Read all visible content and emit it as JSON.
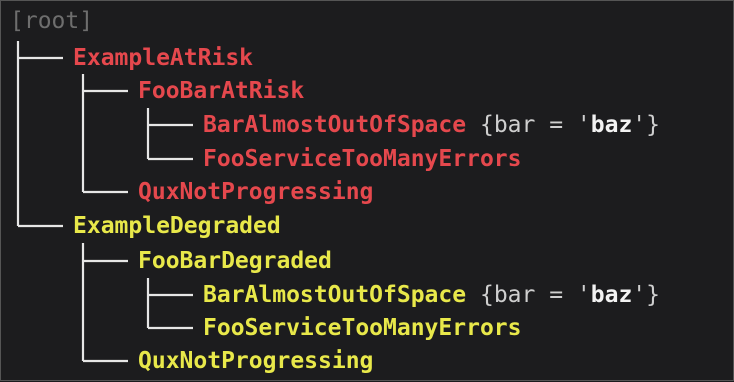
{
  "root": "[root]",
  "colors": {
    "at_risk": "#e5484d",
    "degraded": "#e8e84a",
    "tree_line": "#e6e6e6",
    "root_text": "#6e6e6e",
    "background": "#1c1c1e"
  },
  "groups": [
    {
      "name": "ExampleAtRisk",
      "status": "at-risk",
      "children": [
        {
          "name": "FooBarAtRisk",
          "children": [
            {
              "name": "BarAlmostOutOfSpace",
              "labels": {
                "open": "{bar = '",
                "value": "baz",
                "close": "'}"
              }
            },
            {
              "name": "FooServiceTooManyErrors"
            }
          ]
        },
        {
          "name": "QuxNotProgressing"
        }
      ]
    },
    {
      "name": "ExampleDegraded",
      "status": "degraded",
      "children": [
        {
          "name": "FooBarDegraded",
          "children": [
            {
              "name": "BarAlmostOutOfSpace",
              "labels": {
                "open": "{bar = '",
                "value": "baz",
                "close": "'}"
              }
            },
            {
              "name": "FooServiceTooManyErrors"
            }
          ]
        },
        {
          "name": "QuxNotProgressing"
        }
      ]
    }
  ]
}
